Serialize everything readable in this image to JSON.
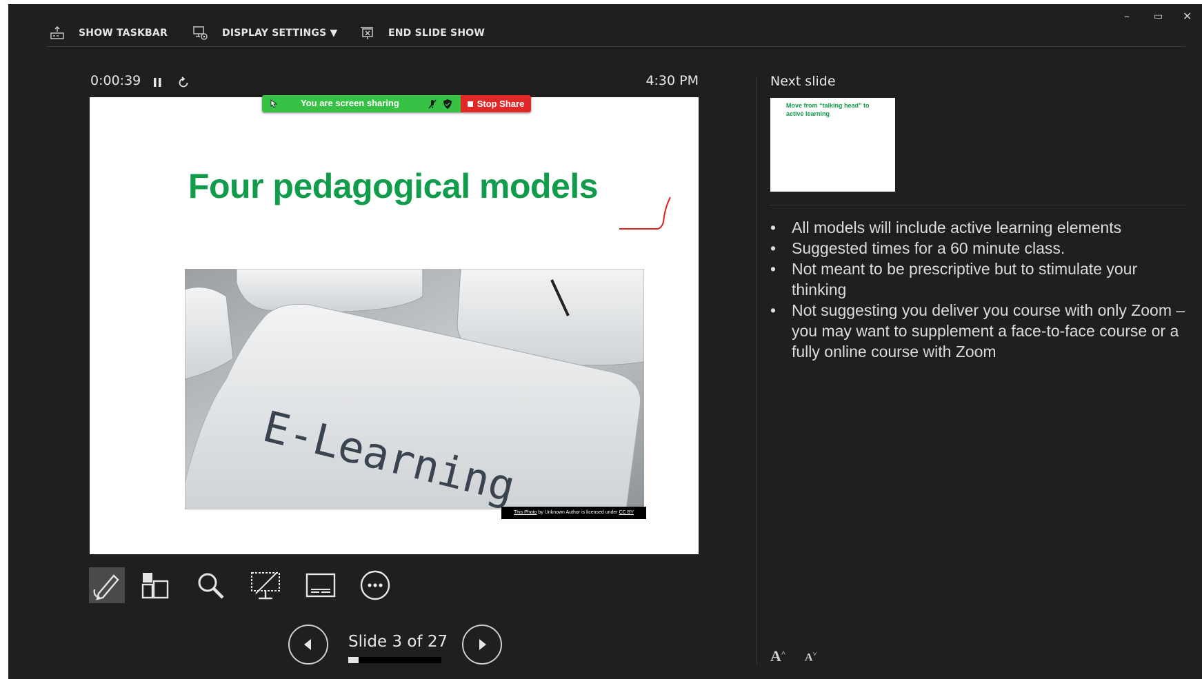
{
  "toolbar": {
    "show_taskbar": "SHOW TASKBAR",
    "display_settings": "DISPLAY SETTINGS ▼",
    "end_slide_show": "END SLIDE SHOW"
  },
  "window_controls": {
    "minimize": "–",
    "restore": "▭",
    "close": "✕"
  },
  "timer": {
    "elapsed": "0:00:39",
    "clock": "4:30 PM"
  },
  "share_bar": {
    "text": "You are screen sharing",
    "stop": "Stop Share",
    "color_green": "#37c245",
    "color_red": "#e02828"
  },
  "slide": {
    "title": "Four pedagogical models",
    "image_caption": "E-Learning",
    "credit_link": "This Photo",
    "credit_mid": " by Unknown Author is licensed under ",
    "credit_license": "CC BY",
    "title_color": "#109c4a"
  },
  "tools": [
    "pen-tool",
    "see-all-slides",
    "zoom-into-slide",
    "black-screen",
    "subtitles",
    "more-options"
  ],
  "navigation": {
    "slide_label": "Slide 3 of 27",
    "current": 3,
    "total": 27
  },
  "next_slide": {
    "header": "Next slide",
    "thumbnail_title": "Move from “talking head” to active learning"
  },
  "notes": [
    "All models will include active learning elements",
    "Suggested times for a 60 minute class.",
    "Not meant to be prescriptive but to stimulate your thinking",
    "Not suggesting you deliver you course with only Zoom – you may want to supplement a face-to-face course or a fully online course with Zoom"
  ],
  "font_controls": {
    "increase": "A",
    "decrease": "A"
  }
}
